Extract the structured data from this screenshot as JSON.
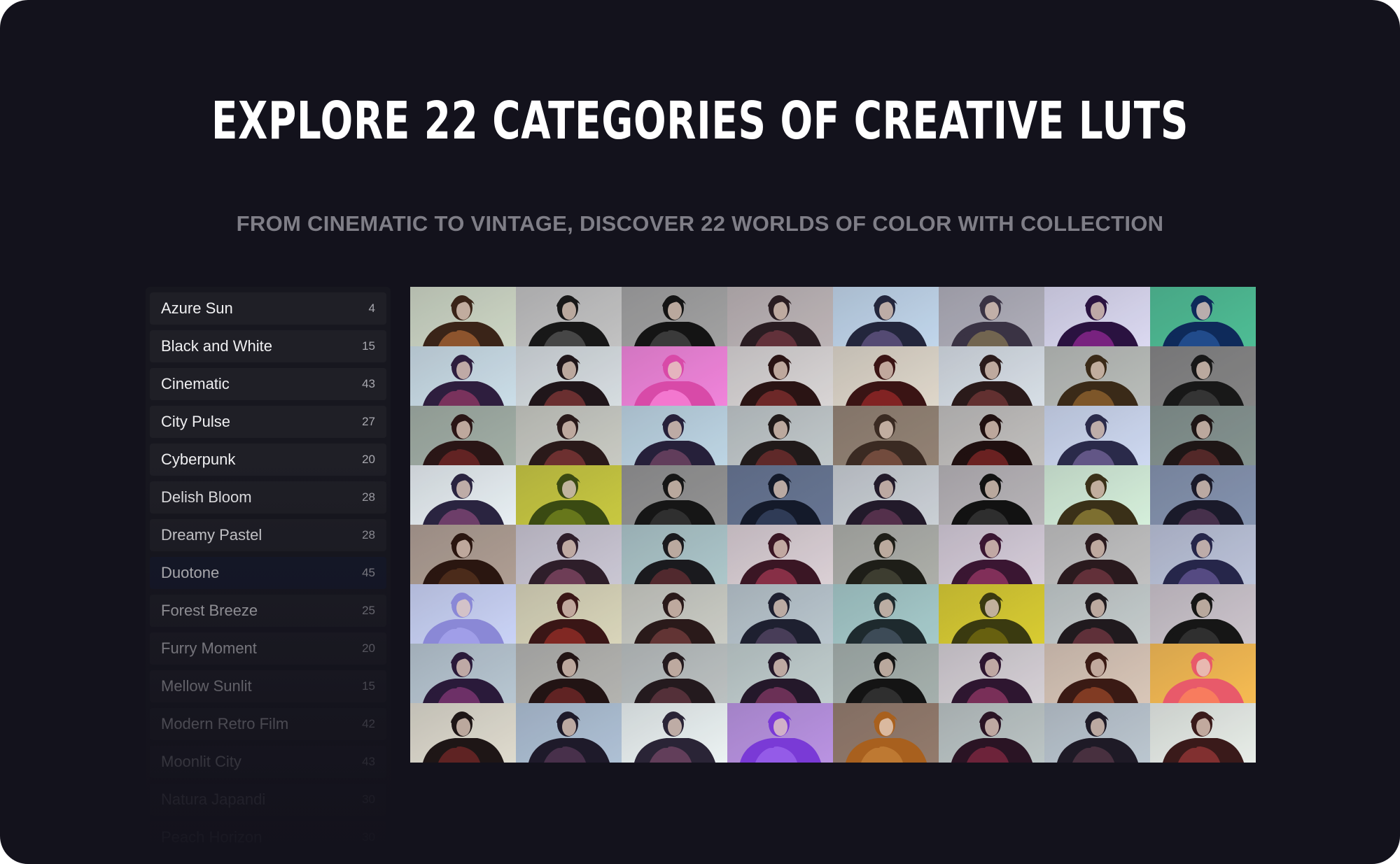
{
  "header": {
    "title": "EXPLORE 22 CATEGORIES OF CREATIVE LUTS",
    "subtitle": "FROM CINEMATIC TO VINTAGE, DISCOVER 22 WORLDS OF COLOR WITH COLLECTION"
  },
  "sidebar": {
    "selected_index": 7,
    "items": [
      {
        "label": "Azure Sun",
        "count": "4"
      },
      {
        "label": "Black and White",
        "count": "15"
      },
      {
        "label": "Cinematic",
        "count": "43"
      },
      {
        "label": "City Pulse",
        "count": "27"
      },
      {
        "label": "Cyberpunk",
        "count": "20"
      },
      {
        "label": "Delish Bloom",
        "count": "28"
      },
      {
        "label": "Dreamy Pastel",
        "count": "28"
      },
      {
        "label": "Duotone",
        "count": "45"
      },
      {
        "label": "Forest Breeze",
        "count": "25"
      },
      {
        "label": "Furry Moment",
        "count": "20"
      },
      {
        "label": "Mellow Sunlit",
        "count": "15"
      },
      {
        "label": "Modern Retro Film",
        "count": "42"
      },
      {
        "label": "Moonlit City",
        "count": "43"
      },
      {
        "label": "Natura Japandi",
        "count": "30"
      },
      {
        "label": "Peach Horizon",
        "count": "30"
      }
    ]
  },
  "preview_grid": {
    "columns": 8,
    "tiles": [
      {
        "bg": "#c9d3c0",
        "body": "#3a2418",
        "accent": "#b06a36"
      },
      {
        "bg": "#bdbdbd",
        "body": "#181818",
        "accent": "#5a5a5a"
      },
      {
        "bg": "#9a9a9a",
        "body": "#141414",
        "accent": "#4a4a4a"
      },
      {
        "bg": "#b7aeb0",
        "body": "#2a1d22",
        "accent": "#7a3a44"
      },
      {
        "bg": "#bcd3ea",
        "body": "#23263c",
        "accent": "#6a5a8a"
      },
      {
        "bg": "#a9a8b4",
        "body": "#3a3344",
        "accent": "#8a7a56"
      },
      {
        "bg": "#d8d6f0",
        "body": "#2a1240",
        "accent": "#9a2a9a"
      },
      {
        "bg": "#3fb88c",
        "body": "#0e2a5a",
        "accent": "#2a5aa0"
      },
      {
        "bg": "#c7dbe6",
        "body": "#2e1e3e",
        "accent": "#9a3a6a"
      },
      {
        "bg": "#d3dade",
        "body": "#20161a",
        "accent": "#8a3a3a"
      },
      {
        "bg": "#f07ad8",
        "body": "#d84aa8",
        "accent": "#ff8ae0"
      },
      {
        "bg": "#d6d2d2",
        "body": "#2a1414",
        "accent": "#8a3030"
      },
      {
        "bg": "#dcd4c6",
        "body": "#3a1414",
        "accent": "#a02a2a"
      },
      {
        "bg": "#d4dce4",
        "body": "#2a1a1a",
        "accent": "#7a3a3a"
      },
      {
        "bg": "#b4b8b4",
        "body": "#3a2a18",
        "accent": "#9a6a30"
      },
      {
        "bg": "#7a7a7a",
        "body": "#181818",
        "accent": "#404040"
      },
      {
        "bg": "#9aa89e",
        "body": "#2a1616",
        "accent": "#7a2a2a"
      },
      {
        "bg": "#c4c6be",
        "body": "#2a1a1a",
        "accent": "#8a3a3a"
      },
      {
        "bg": "#b8d2e2",
        "body": "#26203a",
        "accent": "#7a4a6a"
      },
      {
        "bg": "#bcc4c6",
        "body": "#201a1a",
        "accent": "#7a3030"
      },
      {
        "bg": "#8a7868",
        "body": "#3a2a22",
        "accent": "#8a5a48"
      },
      {
        "bg": "#bcbab8",
        "body": "#201010",
        "accent": "#8a2a2a"
      },
      {
        "bg": "#cad6f0",
        "body": "#2a2a4a",
        "accent": "#7a6aa0"
      },
      {
        "bg": "#7a8a86",
        "body": "#1e1616",
        "accent": "#6a3030"
      },
      {
        "bg": "#e6eef2",
        "body": "#2a2440",
        "accent": "#8a4a7a"
      },
      {
        "bg": "#c4c430",
        "body": "#3a4a12",
        "accent": "#7a8a20"
      },
      {
        "bg": "#8a8a8a",
        "body": "#161616",
        "accent": "#3a3a3a"
      },
      {
        "bg": "#5a6a8a",
        "body": "#141a2a",
        "accent": "#3a4a6a"
      },
      {
        "bg": "#c6ccd2",
        "body": "#221a2a",
        "accent": "#6a3a5a"
      },
      {
        "bg": "#b2aeb2",
        "body": "#121212",
        "accent": "#3a3a3a"
      },
      {
        "bg": "#d2eed8",
        "body": "#3a3018",
        "accent": "#9a8a3a"
      },
      {
        "bg": "#7a8aa8",
        "body": "#1a1a2a",
        "accent": "#5a3a5a"
      },
      {
        "bg": "#a8968a",
        "body": "#2a1610",
        "accent": "#5a3420"
      },
      {
        "bg": "#c6c2d0",
        "body": "#2e1e2a",
        "accent": "#8a4a6a"
      },
      {
        "bg": "#a6c2c6",
        "body": "#1a1a1e",
        "accent": "#6a3034"
      },
      {
        "bg": "#d8ccd2",
        "body": "#3a1624",
        "accent": "#a83a56"
      },
      {
        "bg": "#a6a8a2",
        "body": "#1e1e18",
        "accent": "#4a4a3a"
      },
      {
        "bg": "#d2c8d6",
        "body": "#3a1632",
        "accent": "#a03a6a"
      },
      {
        "bg": "#bcbcbc",
        "body": "#2a1a1e",
        "accent": "#7a3a44"
      },
      {
        "bg": "#b6bed6",
        "body": "#26264a",
        "accent": "#6a5a9a"
      },
      {
        "bg": "#c6d0f6",
        "body": "#8a88d6",
        "accent": "#aaa8f0"
      },
      {
        "bg": "#d6d2b4",
        "body": "#3a1616",
        "accent": "#a0302a"
      },
      {
        "bg": "#c6c8c0",
        "body": "#2a1a1a",
        "accent": "#7a4040"
      },
      {
        "bg": "#b4c2ca",
        "body": "#1e2030",
        "accent": "#5a4a6a"
      },
      {
        "bg": "#9ec6c6",
        "body": "#1e2a2e",
        "accent": "#4a5a6a"
      },
      {
        "bg": "#d6c820",
        "body": "#3a3a10",
        "accent": "#7a7010"
      },
      {
        "bg": "#c0c8c8",
        "body": "#201a1e",
        "accent": "#7a3a44"
      },
      {
        "bg": "#c8c0c8",
        "body": "#161616",
        "accent": "#3a3a3a"
      },
      {
        "bg": "#b2c2ce",
        "body": "#2a1a3a",
        "accent": "#8a3a7a"
      },
      {
        "bg": "#aeaeaa",
        "body": "#221414",
        "accent": "#7a2a2a"
      },
      {
        "bg": "#b6bcbc",
        "body": "#241a1e",
        "accent": "#6a3a44"
      },
      {
        "bg": "#bccaca",
        "body": "#24182a",
        "accent": "#8a3a6a"
      },
      {
        "bg": "#9eaaa6",
        "body": "#141414",
        "accent": "#3a3a3a"
      },
      {
        "bg": "#d2ccd2",
        "body": "#2e1630",
        "accent": "#9a3a6a"
      },
      {
        "bg": "#d6c2b2",
        "body": "#3a1a14",
        "accent": "#a04a2a"
      },
      {
        "bg": "#f6b644",
        "body": "#e85a6a",
        "accent": "#ff8a5a"
      },
      {
        "bg": "#dcd8ca",
        "body": "#1e1616",
        "accent": "#7a2a2a"
      },
      {
        "bg": "#a8bcd2",
        "body": "#1e1a2a",
        "accent": "#5a3a5a"
      },
      {
        "bg": "#eaf2f2",
        "body": "#2a2436",
        "accent": "#7a4a6a"
      },
      {
        "bg": "#b48ae0",
        "body": "#7a3ad6",
        "accent": "#a06af0"
      },
      {
        "bg": "#8a7060",
        "body": "#a8601e",
        "accent": "#c8843a"
      },
      {
        "bg": "#b6c0c0",
        "body": "#2a1424",
        "accent": "#8a2a44"
      },
      {
        "bg": "#b6c2cc",
        "body": "#1e1a26",
        "accent": "#5a3a4a"
      },
      {
        "bg": "#e6ece6",
        "body": "#3a1a1a",
        "accent": "#a03a3a"
      }
    ]
  }
}
